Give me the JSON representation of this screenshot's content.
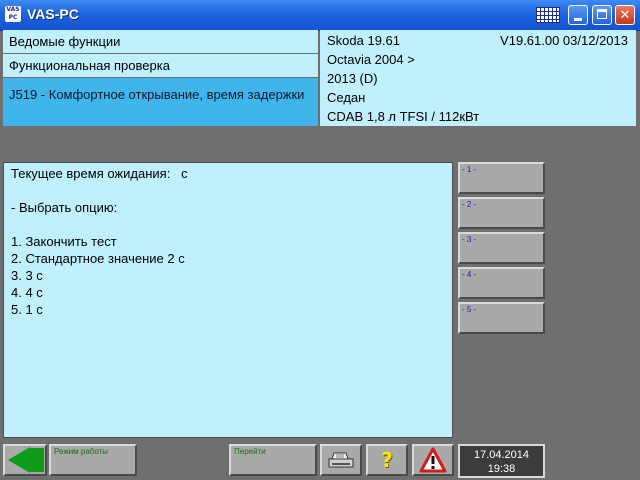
{
  "window": {
    "title": "VAS-PC",
    "app_icon_text": "VAS PC",
    "keyboard_icon": "keyboard-icon",
    "minimize_icon": "minimize-icon",
    "maximize_icon": "maximize-icon",
    "close_label": "✕"
  },
  "header_left": {
    "row1": "Ведомые функции",
    "row2": "Функциональная проверка",
    "row3": "J519 - Комфортное открывание, время задержки"
  },
  "header_right": {
    "line1": "Skoda 19.61",
    "version": "V19.61.00 03/12/2013",
    "line2": "Octavia 2004 >",
    "line3": "2013 (D)",
    "line4": "Седан",
    "line5": "CDAB 1,8 л TFSI / 112кВт"
  },
  "main": {
    "lines": [
      "Текущее время ожидания:   с",
      "- Выбрать опцию:",
      "1. Закончить тест",
      "2. Стандартное значение 2 с",
      "3. 3 с",
      "4. 4 с",
      "5. 1 с"
    ]
  },
  "option_buttons": [
    "- 1 -",
    "- 2 -",
    "- 3 -",
    "- 4 -",
    "- 5 -"
  ],
  "toolbar": {
    "back_icon": "back-arrow-icon",
    "mode_label": "Режим работы",
    "goto_label": "Перейти",
    "print_icon": "printer-icon",
    "help_label": "?",
    "warning_icon": "warning-icon",
    "date": "17.04.2014",
    "time": "19:38"
  },
  "colors": {
    "panel_bg": "#c0f0fc",
    "selected_bg": "#3fb5ec",
    "title_bar": "#1f63de",
    "background": "#6f6f6f",
    "button_bg": "#a9a9a9"
  }
}
